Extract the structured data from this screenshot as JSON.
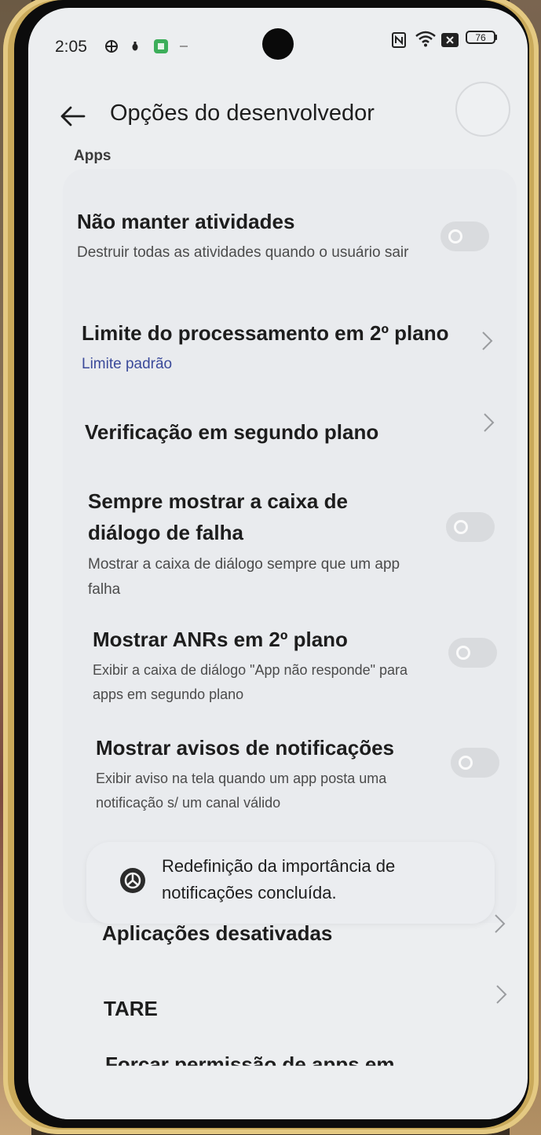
{
  "status_bar": {
    "time": "2:05",
    "battery": "76"
  },
  "header": {
    "back_icon": "arrow-left-icon",
    "title": "Opções do desenvolvedor"
  },
  "section": {
    "label": "Apps"
  },
  "items": [
    {
      "title": "Não manter atividades",
      "subtitle": "Destruir todas as atividades quando o usuário sair",
      "control": "toggle",
      "checked": false
    },
    {
      "title": "Limite do processamento em 2º plano",
      "subtitle": "Limite padrão",
      "control": "chevron"
    },
    {
      "title": "Verificação em segundo plano",
      "control": "chevron"
    },
    {
      "title": "Sempre mostrar a caixa de diálogo de falha",
      "subtitle": "Mostrar a caixa de diálogo sempre que um app falha",
      "control": "toggle",
      "checked": false
    },
    {
      "title": "Mostrar ANRs em 2º plano",
      "subtitle": "Exibir a caixa de diálogo \"App não responde\" para apps em segundo plano",
      "control": "toggle",
      "checked": false
    },
    {
      "title": "Mostrar avisos de notificações",
      "subtitle": "Exibir aviso na tela quando um app posta uma notificação s/ um canal válido",
      "control": "toggle",
      "checked": false
    },
    {
      "title": "Aplicações desativadas",
      "control": "chevron"
    },
    {
      "title": "TARE",
      "control": "chevron"
    },
    {
      "title": "Forçar permissão de apps em"
    }
  ],
  "toast": {
    "icon": "app-logo-icon",
    "text": "Redefinição da importância de notificações concluída."
  },
  "colors": {
    "screen_bg": "#eceef0",
    "card_bg": "#e9ebee",
    "accent_text": "#3b4a9a",
    "toggle_off": "#d9dbde"
  }
}
